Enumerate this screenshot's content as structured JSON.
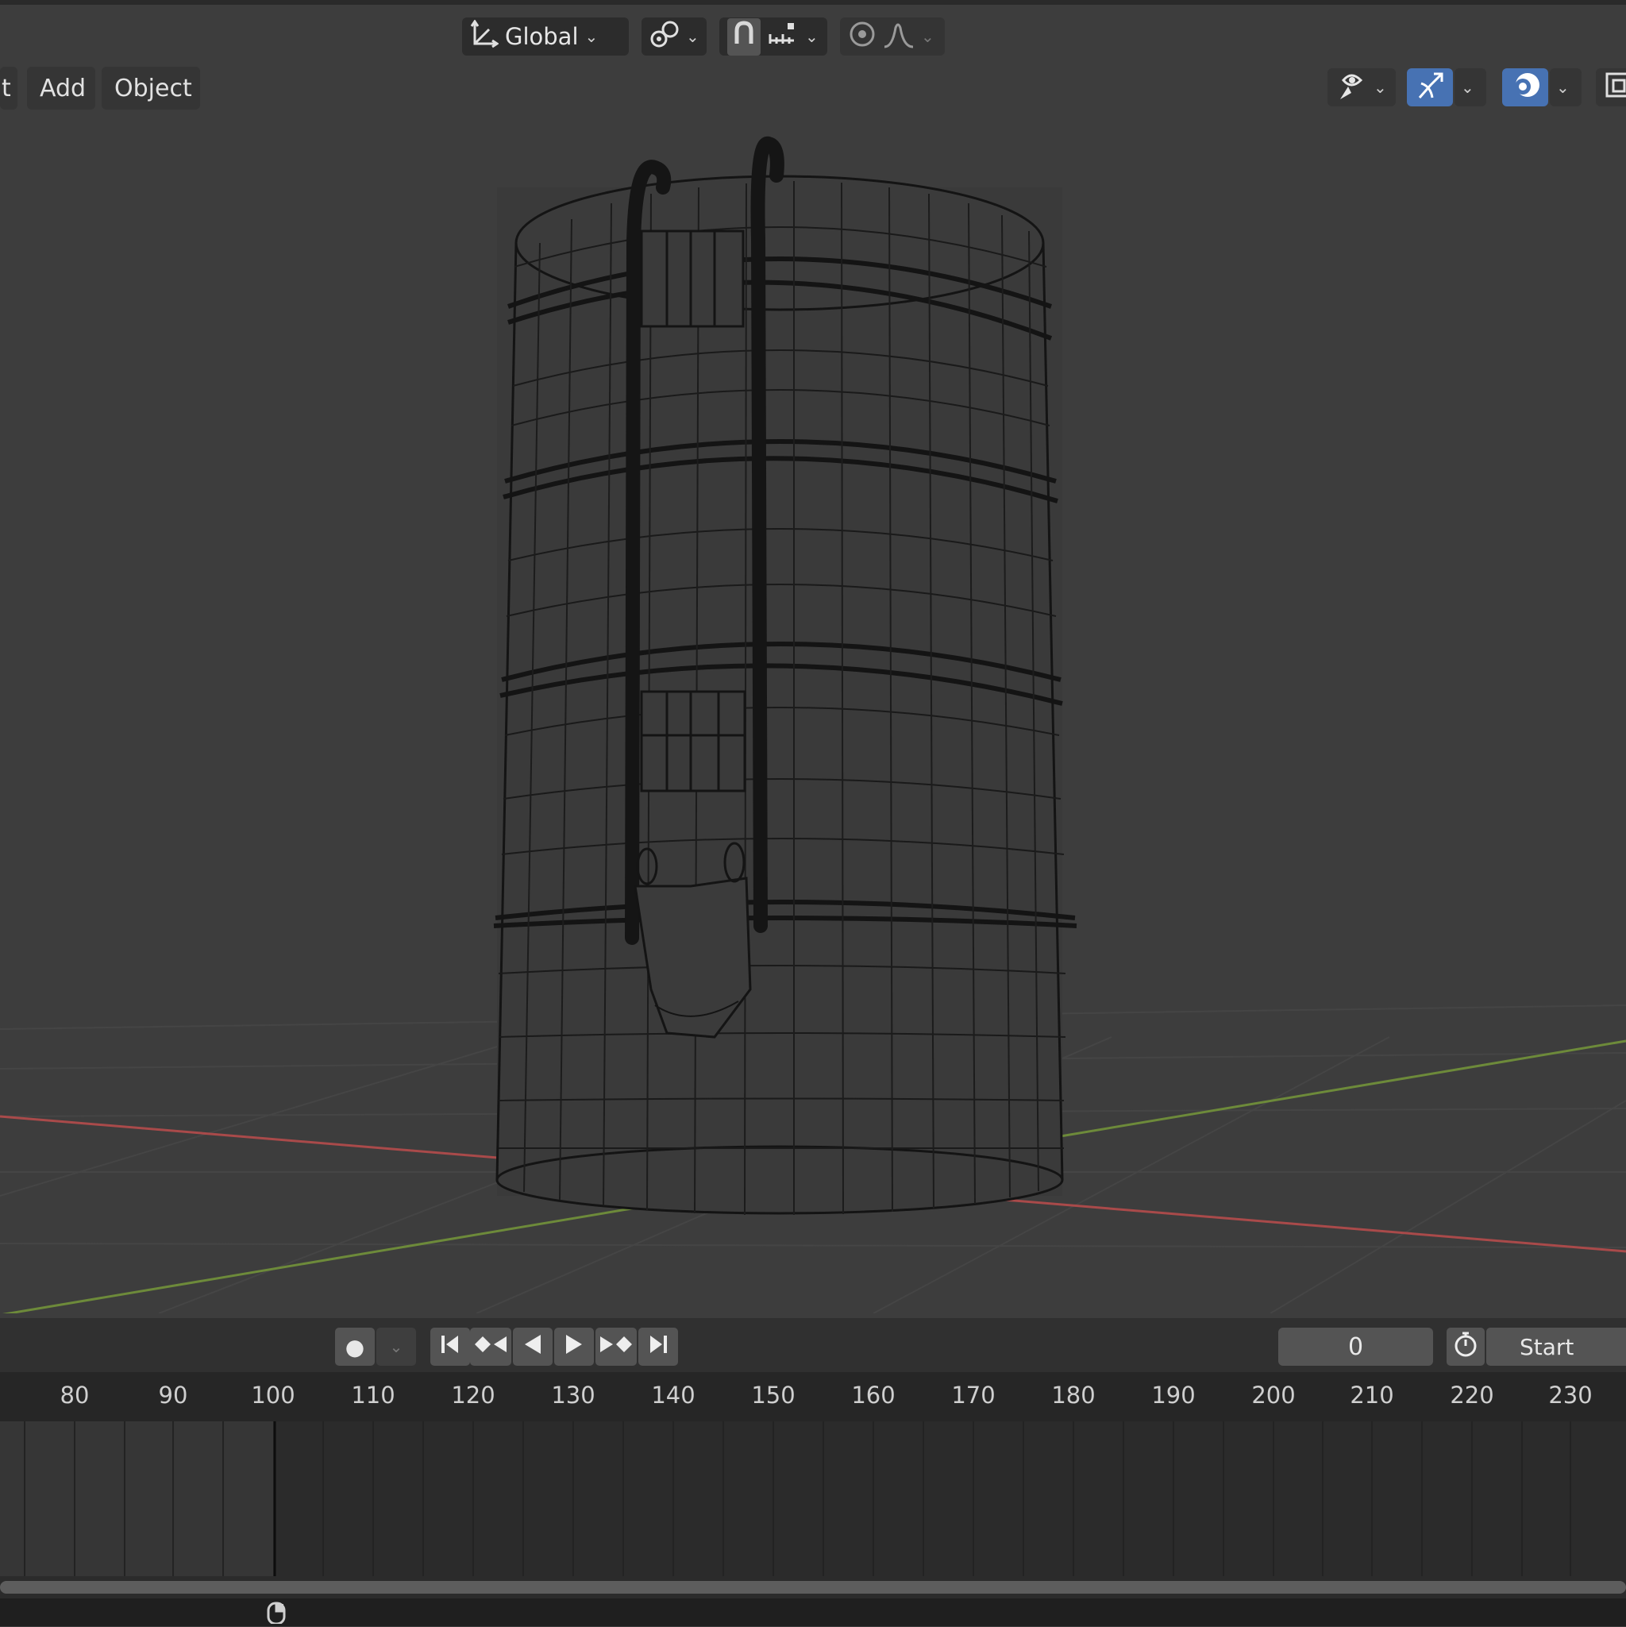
{
  "header": {
    "transform_orientation": "Global",
    "menus": [
      "t",
      "Add",
      "Object"
    ]
  },
  "playback": {
    "current_frame": "0",
    "start_label": "Start"
  },
  "timeline": {
    "ruler_labels": [
      "80",
      "90",
      "100",
      "110",
      "120",
      "130",
      "140",
      "150",
      "160",
      "170",
      "180",
      "190",
      "200",
      "210",
      "220",
      "230"
    ]
  },
  "colors": {
    "active_button": "#4772b3",
    "x_axis": "#a94a4a",
    "y_axis": "#6d8a3a",
    "wire": "#111111"
  },
  "icons": [
    "transform-orientation-icon",
    "pivot-icon",
    "snap-magnet-icon",
    "snap-increment-icon",
    "proportional-edit-icon",
    "falloff-curve-icon",
    "visibility-icon",
    "gizmo-icon",
    "overlay-icon",
    "xray-icon",
    "record-icon",
    "jump-start-icon",
    "prev-keyframe-icon",
    "play-reverse-icon",
    "play-icon",
    "next-keyframe-icon",
    "jump-end-icon",
    "stopwatch-icon",
    "mouse-icon"
  ]
}
